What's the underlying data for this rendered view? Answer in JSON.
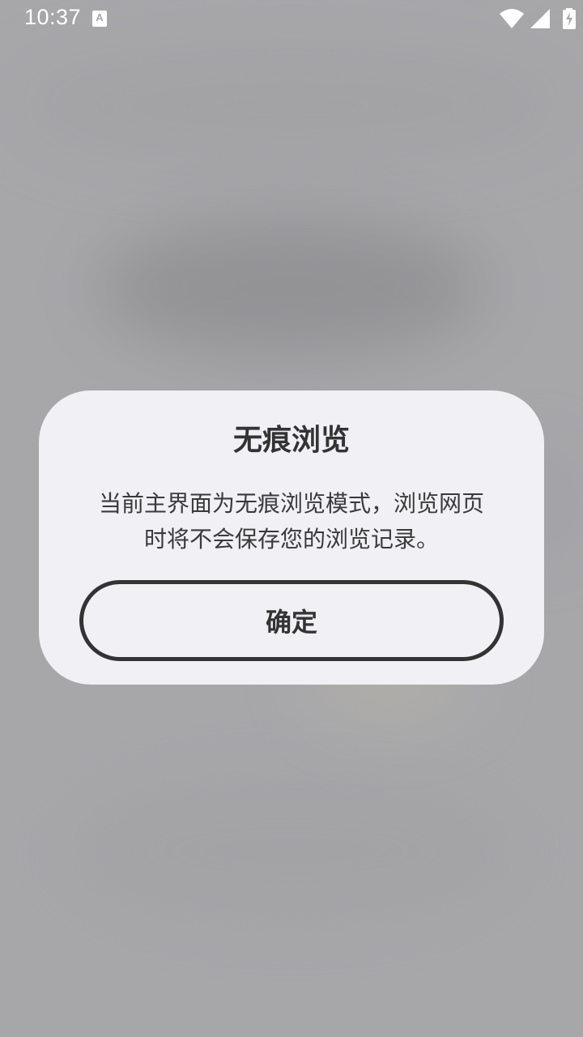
{
  "status_bar": {
    "time": "10:37",
    "notification_icon": "a-text-icon",
    "icons": [
      "wifi-icon",
      "cell-signal-icon",
      "battery-charging-icon"
    ],
    "icon_color": "#ffffff"
  },
  "dialog": {
    "title": "无痕浏览",
    "message_line1": "当前主界面为无痕浏览模式，浏览网页",
    "message_line2": "时将不会保存您的浏览记录。",
    "confirm_label": "确定",
    "background_color": "#f0f0f5",
    "text_color": "#333333"
  },
  "backdrop_color": "#a7a7aa"
}
